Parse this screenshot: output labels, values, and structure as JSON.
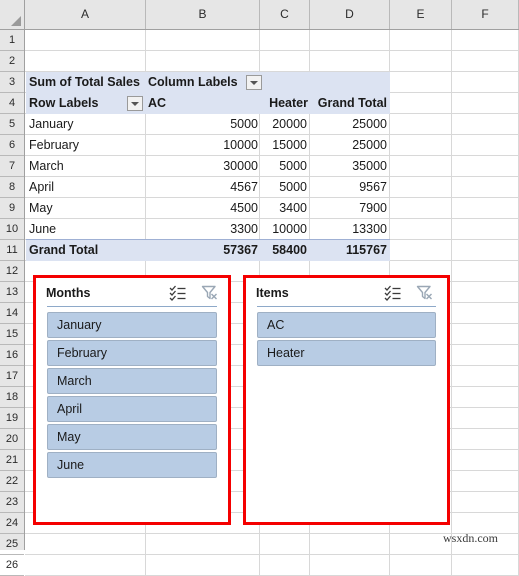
{
  "grid": {
    "column_headers": [
      "A",
      "B",
      "C",
      "D",
      "E",
      "F"
    ],
    "row_headers": [
      "1",
      "2",
      "3",
      "4",
      "5",
      "6",
      "7",
      "8",
      "9",
      "10",
      "11",
      "12",
      "13",
      "14",
      "15",
      "16",
      "17",
      "18",
      "19",
      "20",
      "21",
      "22",
      "23",
      "24",
      "25",
      "26"
    ]
  },
  "pivot": {
    "value_field_label": "Sum of Total Sales",
    "column_labels_header": "Column Labels",
    "row_labels_header": "Row Labels",
    "column_headers": [
      "AC",
      "Heater",
      "Grand Total"
    ],
    "rows": [
      {
        "label": "January",
        "ac": "5000",
        "heater": "20000",
        "total": "25000"
      },
      {
        "label": "February",
        "ac": "10000",
        "heater": "15000",
        "total": "25000"
      },
      {
        "label": "March",
        "ac": "30000",
        "heater": "5000",
        "total": "35000"
      },
      {
        "label": "April",
        "ac": "4567",
        "heater": "5000",
        "total": "9567"
      },
      {
        "label": "May",
        "ac": "4500",
        "heater": "3400",
        "total": "7900"
      },
      {
        "label": "June",
        "ac": "3300",
        "heater": "10000",
        "total": "13300"
      }
    ],
    "grand_total": {
      "label": "Grand Total",
      "ac": "57367",
      "heater": "58400",
      "total": "115767"
    },
    "header_fill": "#dce3f2"
  },
  "slicers": [
    {
      "title": "Months",
      "items": [
        "January",
        "February",
        "March",
        "April",
        "May",
        "June"
      ],
      "multiselect_icon": "multi-select-icon",
      "clear_filter_icon": "clear-filter-icon",
      "item_fill": "#b8cce4",
      "highlight_border": "#f40000"
    },
    {
      "title": "Items",
      "items": [
        "AC",
        "Heater"
      ],
      "multiselect_icon": "multi-select-icon",
      "clear_filter_icon": "clear-filter-icon",
      "item_fill": "#b8cce4",
      "highlight_border": "#f40000"
    }
  ],
  "watermark": {
    "text": "wsxdn.com"
  }
}
